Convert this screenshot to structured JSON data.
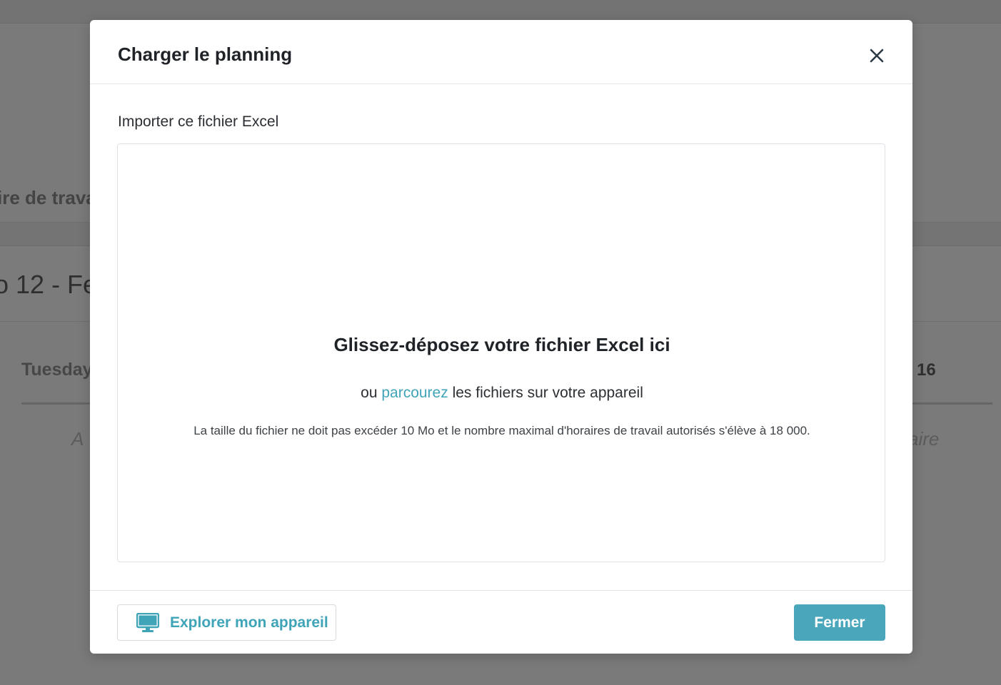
{
  "background": {
    "tab_fragment": "ire de trava",
    "week_fragment": "o 12 - Fe",
    "day_label": "Tuesday",
    "day_number": "16",
    "add_left_fragment": "A",
    "add_right_fragment": "aire"
  },
  "modal": {
    "title": "Charger le planning",
    "close_icon": "close-icon",
    "import_label": "Importer ce fichier Excel",
    "dropzone": {
      "title": "Glissez-déposez votre fichier Excel ici",
      "sub_prefix": "ou",
      "sub_link": "parcourez",
      "sub_suffix": "les fichiers sur votre appareil",
      "note": "La taille du fichier ne doit pas excéder 10 Mo et le nombre maximal d'horaires de travail autorisés s'élève à 18 000."
    },
    "footer": {
      "explore_label": "Explorer mon appareil",
      "explore_icon": "monitor-icon",
      "close_label": "Fermer"
    }
  },
  "colors": {
    "accent": "#3fa4b8",
    "primary_button": "#4aa6bb",
    "overlay": "#7a7a7a"
  }
}
